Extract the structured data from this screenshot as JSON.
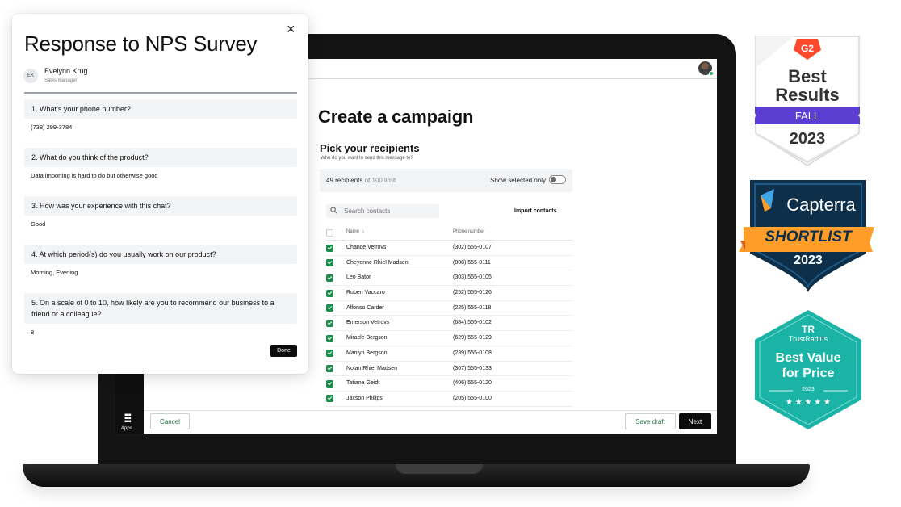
{
  "campaign": {
    "title": "Create a campaign",
    "section_title": "Pick your recipients",
    "section_subtitle": "Who do you want to send this message to?",
    "recipients_count": "49 recipients",
    "recipients_limit": "of 100 limit",
    "show_selected_label": "Show selected only",
    "search_placeholder": "Search contacts",
    "import_label": "Import contacts",
    "col_name": "Name",
    "col_phone": "Phone number",
    "sort_arrow": "↓",
    "contacts": [
      {
        "name": "Chance Vetrovs",
        "phone": "(302) 555-0107"
      },
      {
        "name": "Cheyenne Rhiel Madsen",
        "phone": "(808) 555-0111"
      },
      {
        "name": "Leo Bator",
        "phone": "(303) 555-0105"
      },
      {
        "name": "Ruben Vaccaro",
        "phone": "(252) 555-0126"
      },
      {
        "name": "Alfonso Carder",
        "phone": "(225) 555-0118"
      },
      {
        "name": "Emerson Vetrovs",
        "phone": "(684) 555-0102"
      },
      {
        "name": "Miracle Bergson",
        "phone": "(629) 555-0129"
      },
      {
        "name": "Marilyn Bergson",
        "phone": "(239) 555-0108"
      },
      {
        "name": "Nolan Rhiel Madsen",
        "phone": "(307) 555-0133"
      },
      {
        "name": "Tatiana Geidt",
        "phone": "(406) 555-0120"
      },
      {
        "name": "Jaxson Philips",
        "phone": "(205) 555-0100"
      }
    ],
    "cancel_label": "Cancel",
    "save_draft_label": "Save draft",
    "next_label": "Next",
    "apps_label": "Apps"
  },
  "modal": {
    "title": "Response to NPS Survey",
    "close_glyph": "×",
    "user_initials": "EK",
    "user_name": "Evelynn Krug",
    "user_role": "Sales manager",
    "questions": [
      {
        "q": "1.  What’s your phone number?",
        "a": "(738) 299-3784"
      },
      {
        "q": "2. What do you think of the product?",
        "a": "Data importing is hard to do but otherwise good"
      },
      {
        "q": "3.  How was your experience with this chat?",
        "a": "Good"
      },
      {
        "q": "4.  At which period(s) do you usually work on our product?",
        "a": "Morning, Evening"
      },
      {
        "q": "5.  On a scale of 0 to 10, how likely are you to recommend our business to a friend or a colleague?",
        "a": "8"
      }
    ],
    "done_label": "Done"
  },
  "badges": {
    "g2": {
      "logo": "G2",
      "line1": "Best",
      "line2": "Results",
      "ribbon": "FALL",
      "year": "2023",
      "color": "#5b3fd3"
    },
    "capterra": {
      "name": "Capterra",
      "ribbon": "SHORTLIST",
      "year": "2023",
      "bg": "#0e2f4a",
      "ribbon_color": "#ff9d28"
    },
    "trustradius": {
      "logo": "TR",
      "name": "TrustRadius",
      "line1": "Best Value",
      "line2": "for Price",
      "year": "2023",
      "stars": "★ ★ ★ ★ ★",
      "color": "#1bb3a5"
    }
  }
}
